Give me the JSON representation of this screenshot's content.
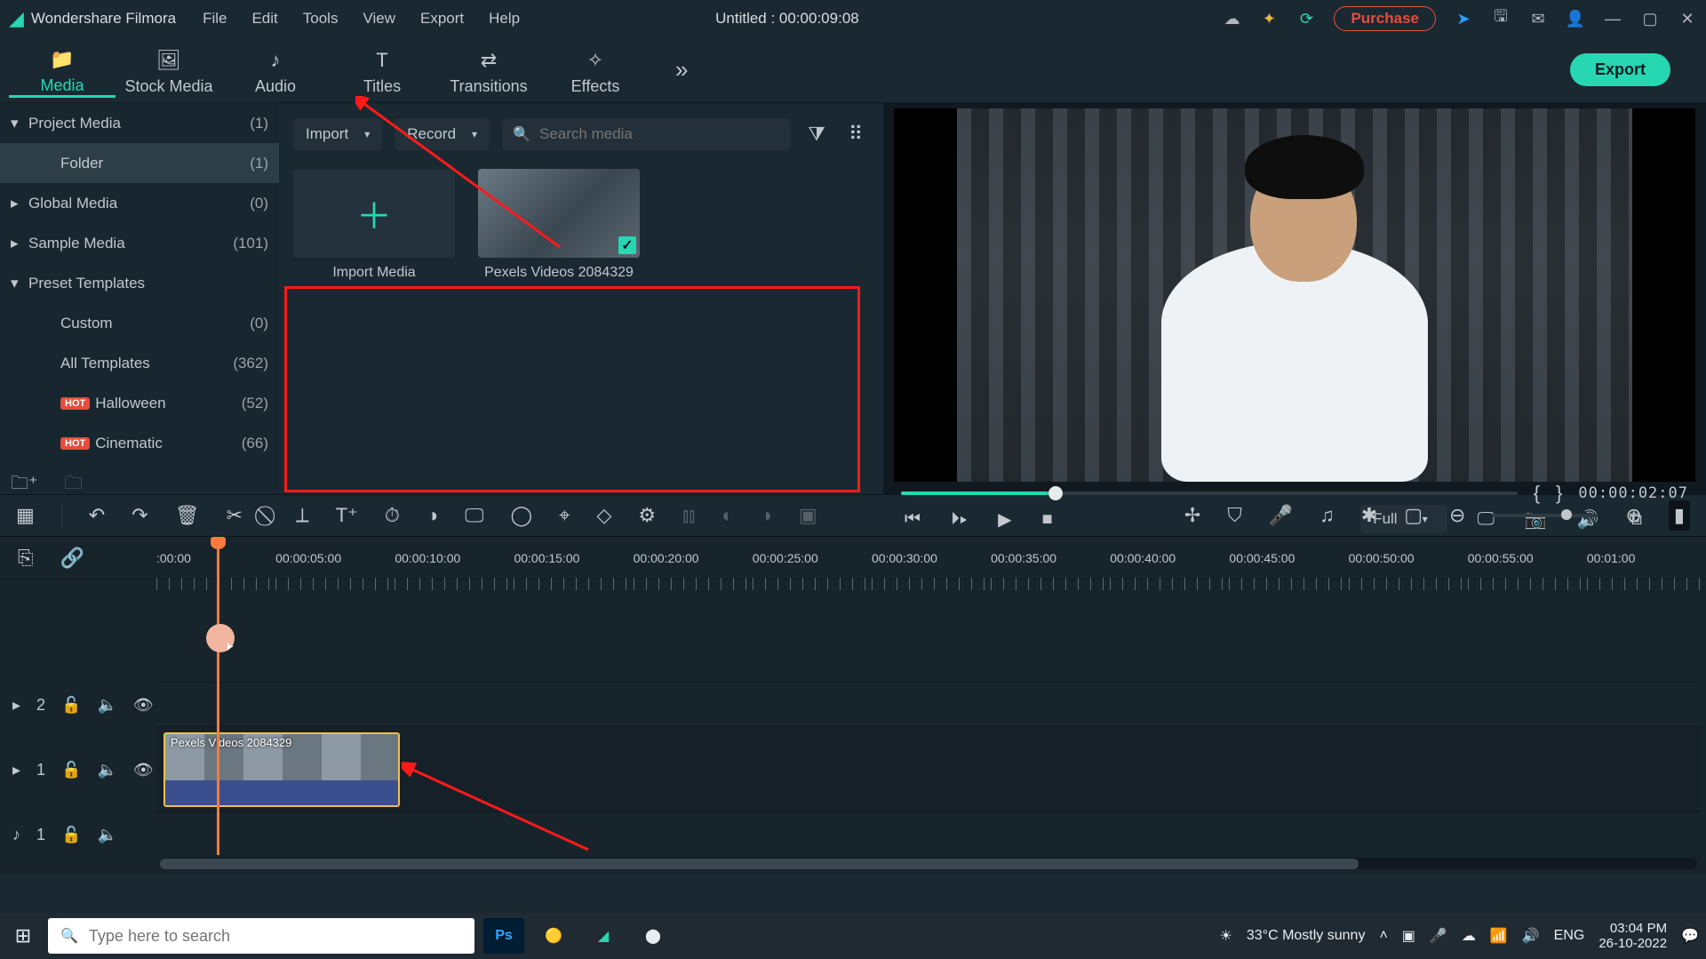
{
  "app_name": "Wondershare Filmora",
  "menu": [
    "File",
    "Edit",
    "Tools",
    "View",
    "Export",
    "Help"
  ],
  "project_title": "Untitled : 00:00:09:08",
  "purchase_label": "Purchase",
  "tabs": [
    {
      "label": "Media",
      "icon": "📁",
      "active": true
    },
    {
      "label": "Stock Media",
      "icon": "🖼",
      "active": false
    },
    {
      "label": "Audio",
      "icon": "♪",
      "active": false
    },
    {
      "label": "Titles",
      "icon": "T",
      "active": false
    },
    {
      "label": "Transitions",
      "icon": "⇄",
      "active": false
    },
    {
      "label": "Effects",
      "icon": "✧",
      "active": false
    }
  ],
  "export_label": "Export",
  "library": [
    {
      "label": "Project Media",
      "count": "(1)",
      "chev": "▾",
      "indent": false,
      "sel": false
    },
    {
      "label": "Folder",
      "count": "(1)",
      "chev": "",
      "indent": true,
      "sel": true
    },
    {
      "label": "Global Media",
      "count": "(0)",
      "chev": "▸",
      "indent": false,
      "sel": false
    },
    {
      "label": "Sample Media",
      "count": "(101)",
      "chev": "▸",
      "indent": false,
      "sel": false
    },
    {
      "label": "Preset Templates",
      "count": "",
      "chev": "▾",
      "indent": false,
      "sel": false
    },
    {
      "label": "Custom",
      "count": "(0)",
      "chev": "",
      "indent": true,
      "sel": false
    },
    {
      "label": "All Templates",
      "count": "(362)",
      "chev": "",
      "indent": true,
      "sel": false
    },
    {
      "label": "Halloween",
      "count": "(52)",
      "chev": "",
      "indent": true,
      "sel": false,
      "hot": true
    },
    {
      "label": "Cinematic",
      "count": "(66)",
      "chev": "",
      "indent": true,
      "sel": false,
      "hot": true
    }
  ],
  "assets_bar": {
    "import_label": "Import",
    "record_label": "Record",
    "search_placeholder": "Search media"
  },
  "thumbs": {
    "import_caption": "Import Media",
    "clip1_caption": "Pexels Videos 2084329"
  },
  "preview": {
    "timecode": "00:00:02:07",
    "quality_label": "Full"
  },
  "ruler": [
    ":00:00",
    "00:00:05:00",
    "00:00:10:00",
    "00:00:15:00",
    "00:00:20:00",
    "00:00:25:00",
    "00:00:30:00",
    "00:00:35:00",
    "00:00:40:00",
    "00:00:45:00",
    "00:00:50:00",
    "00:00:55:00",
    "00:01:00"
  ],
  "tracks": {
    "v2": "2",
    "v1": "1",
    "a1": "1"
  },
  "clip_label": "Pexels Videos 2084329",
  "taskbar": {
    "search_placeholder": "Type here to search",
    "weather": "33°C  Mostly sunny",
    "lang": "ENG",
    "time": "03:04 PM",
    "date": "26-10-2022"
  }
}
